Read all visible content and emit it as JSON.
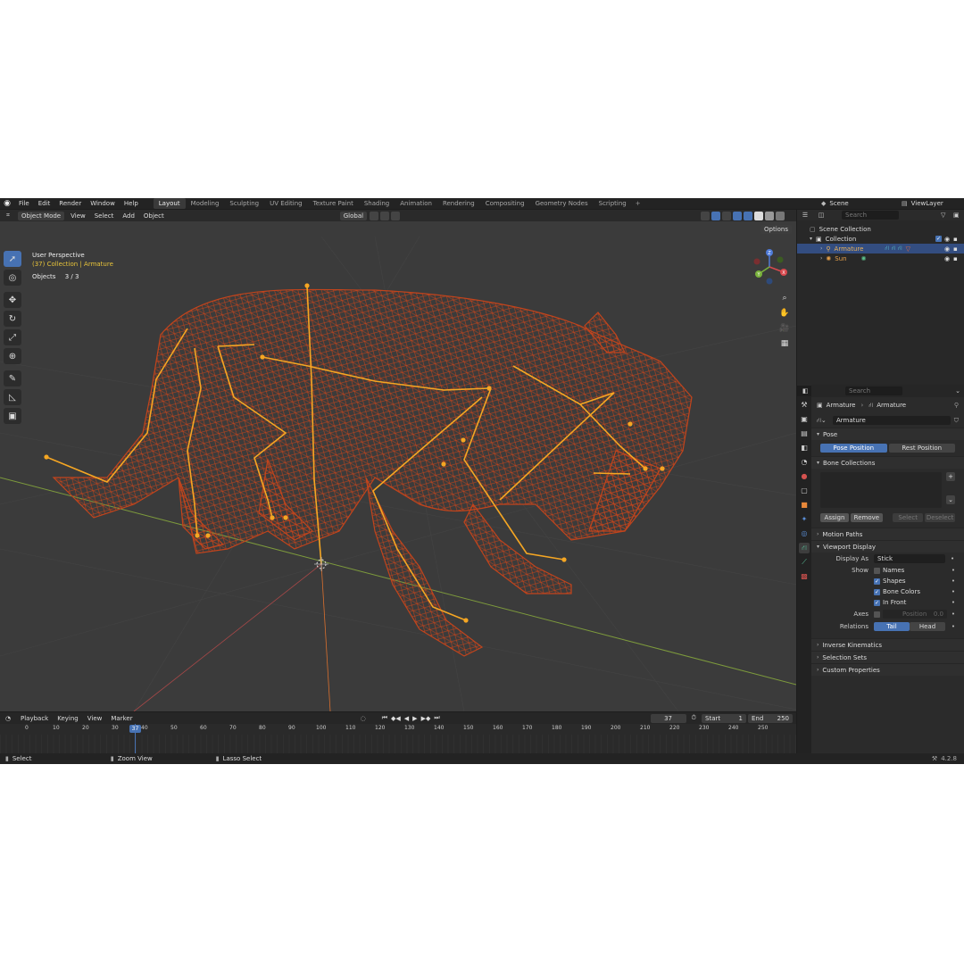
{
  "topbar": {
    "menus": [
      "File",
      "Edit",
      "Render",
      "Window",
      "Help"
    ],
    "workspaces": [
      "Layout",
      "Modeling",
      "Sculpting",
      "UV Editing",
      "Texture Paint",
      "Shading",
      "Animation",
      "Rendering",
      "Compositing",
      "Geometry Nodes",
      "Scripting"
    ],
    "active_workspace": "Layout",
    "scene": "Scene",
    "view_layer": "ViewLayer"
  },
  "viewport_header": {
    "mode": "Object Mode",
    "menus": [
      "View",
      "Select",
      "Add",
      "Object"
    ],
    "orientation": "Global",
    "options": "Options"
  },
  "viewport_overlay": {
    "view_name": "User Perspective",
    "collection_line": "(37) Collection | Armature",
    "objects_label": "Objects",
    "objects_count": "3 / 3"
  },
  "gizmo": {
    "x": "X",
    "y": "Y",
    "z": "Z"
  },
  "outliner": {
    "search_placeholder": "Search",
    "scene_collection": "Scene Collection",
    "collection": "Collection",
    "items": [
      {
        "name": "Armature",
        "selected": true
      },
      {
        "name": "Sun",
        "selected": false
      }
    ]
  },
  "properties": {
    "search_placeholder": "Search",
    "breadcrumb_object": "Armature",
    "breadcrumb_data": "Armature",
    "data_name": "Armature",
    "pose_panel": "Pose",
    "pose_position": "Pose Position",
    "rest_position": "Rest Position",
    "bone_collections_panel": "Bone Collections",
    "assign": "Assign",
    "remove": "Remove",
    "select": "Select",
    "deselect": "Deselect",
    "motion_paths_panel": "Motion Paths",
    "viewport_display_panel": "Viewport Display",
    "display_as_label": "Display As",
    "display_as_value": "Stick",
    "show_label": "Show",
    "show_names": "Names",
    "show_shapes": "Shapes",
    "show_bone_colors": "Bone Colors",
    "show_in_front": "In Front",
    "axes_label": "Axes",
    "axes_position_label": "Position",
    "axes_position_value": "0.0",
    "relations_label": "Relations",
    "relations_tail": "Tail",
    "relations_head": "Head",
    "ik_panel": "Inverse Kinematics",
    "selection_sets_panel": "Selection Sets",
    "custom_props_panel": "Custom Properties"
  },
  "timeline": {
    "menus": [
      "Playback",
      "Keying",
      "View",
      "Marker"
    ],
    "current_frame": "37",
    "start_label": "Start",
    "start_value": "1",
    "end_label": "End",
    "end_value": "250",
    "ticks": [
      "0",
      "10",
      "20",
      "30",
      "40",
      "50",
      "60",
      "70",
      "80",
      "90",
      "100",
      "110",
      "120",
      "130",
      "140",
      "150",
      "160",
      "170",
      "180",
      "190",
      "200",
      "210",
      "220",
      "230",
      "240",
      "250"
    ]
  },
  "statusbar": {
    "select": "Select",
    "zoom_view": "Zoom View",
    "lasso_select": "Lasso Select",
    "version": "4.2.8"
  },
  "colors": {
    "accent": "#4772b3",
    "wire": "#c2441c",
    "bone": "#f5a623",
    "viewport_bg": "#3b3b3b"
  }
}
